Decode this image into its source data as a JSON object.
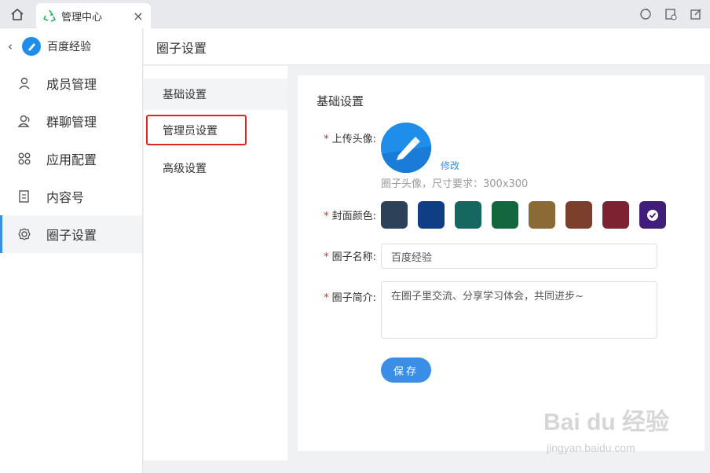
{
  "tabbar": {
    "tab_title": "管理中心",
    "tab_close": "×",
    "tab_icon": "recycle-icon",
    "tools": [
      "refresh-icon",
      "note-icon",
      "edit-icon"
    ]
  },
  "sidebar": {
    "back": "‹",
    "name": "百度经验",
    "items": [
      {
        "label": "成员管理",
        "icon": "member-icon"
      },
      {
        "label": "群聊管理",
        "icon": "group-chat-icon"
      },
      {
        "label": "应用配置",
        "icon": "apps-icon"
      },
      {
        "label": "内容号",
        "icon": "content-icon"
      },
      {
        "label": "圈子设置",
        "icon": "gear-icon"
      }
    ]
  },
  "header": {
    "title": "圈子设置"
  },
  "subnav": {
    "items": [
      {
        "label": "基础设置"
      },
      {
        "label": "管理员设置"
      },
      {
        "label": "高级设置"
      }
    ]
  },
  "form": {
    "title": "基础设置",
    "required_mark": "*",
    "avatar_label": "上传头像:",
    "modify": "修改",
    "avatar_hint": "圈子头像，尺寸要求：300x300",
    "color_label": "封面颜色:",
    "colors": [
      "#2d4159",
      "#103e84",
      "#156760",
      "#13673f",
      "#8b6a36",
      "#7c3f2c",
      "#7c2230",
      "#3f1d78"
    ],
    "selected_color_index": 7,
    "name_label": "圈子名称:",
    "name_value": "百度经验",
    "intro_label": "圈子简介:",
    "intro_value": "在圈子里交流、分享学习体会，共同进步~",
    "save": "保存"
  },
  "watermark": {
    "text": "Bai du 经验",
    "url": "jingyan.baidu.com"
  }
}
